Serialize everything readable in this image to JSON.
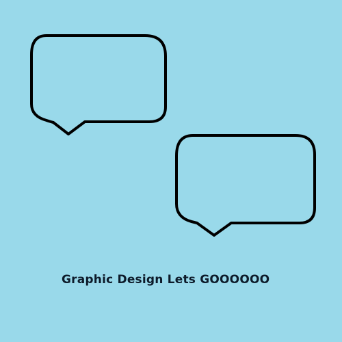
{
  "colors": {
    "background": "#99d9ea",
    "stroke": "#000000",
    "text": "#0d1b2a"
  },
  "shapes": [
    {
      "icon": "speech-bubble-icon",
      "tail": "bottom-left"
    },
    {
      "icon": "speech-bubble-icon",
      "tail": "bottom-left"
    }
  ],
  "caption": "Graphic Design Lets GOOOOOO"
}
